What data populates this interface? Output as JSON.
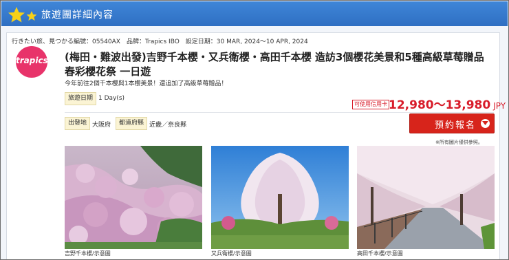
{
  "header": {
    "title": "旅遊團詳細內容"
  },
  "tour": {
    "meta": "行きたい旅、見つかる編號：05540AX　品牌：Trapics IBO　設定日期：30 MAR, 2024～10 APR, 2024",
    "logo_text": "trapics",
    "title_line1": "(梅田・難波出發)吉野千本櫻・又兵衛櫻・高田千本櫻 造訪3個櫻花美景和5種高級草莓贈品",
    "title_line2": "春彩櫻花祭 一日遊",
    "subtitle": "今年前往2個千本櫻與1本櫻美景！還追加了高級草莓贈品！",
    "duration_label": "旅遊日期",
    "duration_value": "1 Day(s)",
    "departure_label": "出發地",
    "departure_value": "大阪府",
    "visit_label": "都道府縣",
    "visit_value": "近畿／奈良縣",
    "credit_badge": "可使用信用卡",
    "price": "12,980～13,980",
    "currency": "JPY",
    "book_label": "預約報名",
    "photo_note": "※所有圖片僅供參照。"
  },
  "photos": [
    {
      "caption": "吉野千本櫻/示意圖"
    },
    {
      "caption": "又兵衛櫻/示意圖"
    },
    {
      "caption": "高田千本櫻/示意圖"
    }
  ],
  "colors": {
    "header_blue": "#3a7fd2",
    "price_red": "#d81c2a",
    "button_red": "#d7241b",
    "logo_pink": "#e8336a",
    "tag_yellow": "#fbf4d4"
  }
}
